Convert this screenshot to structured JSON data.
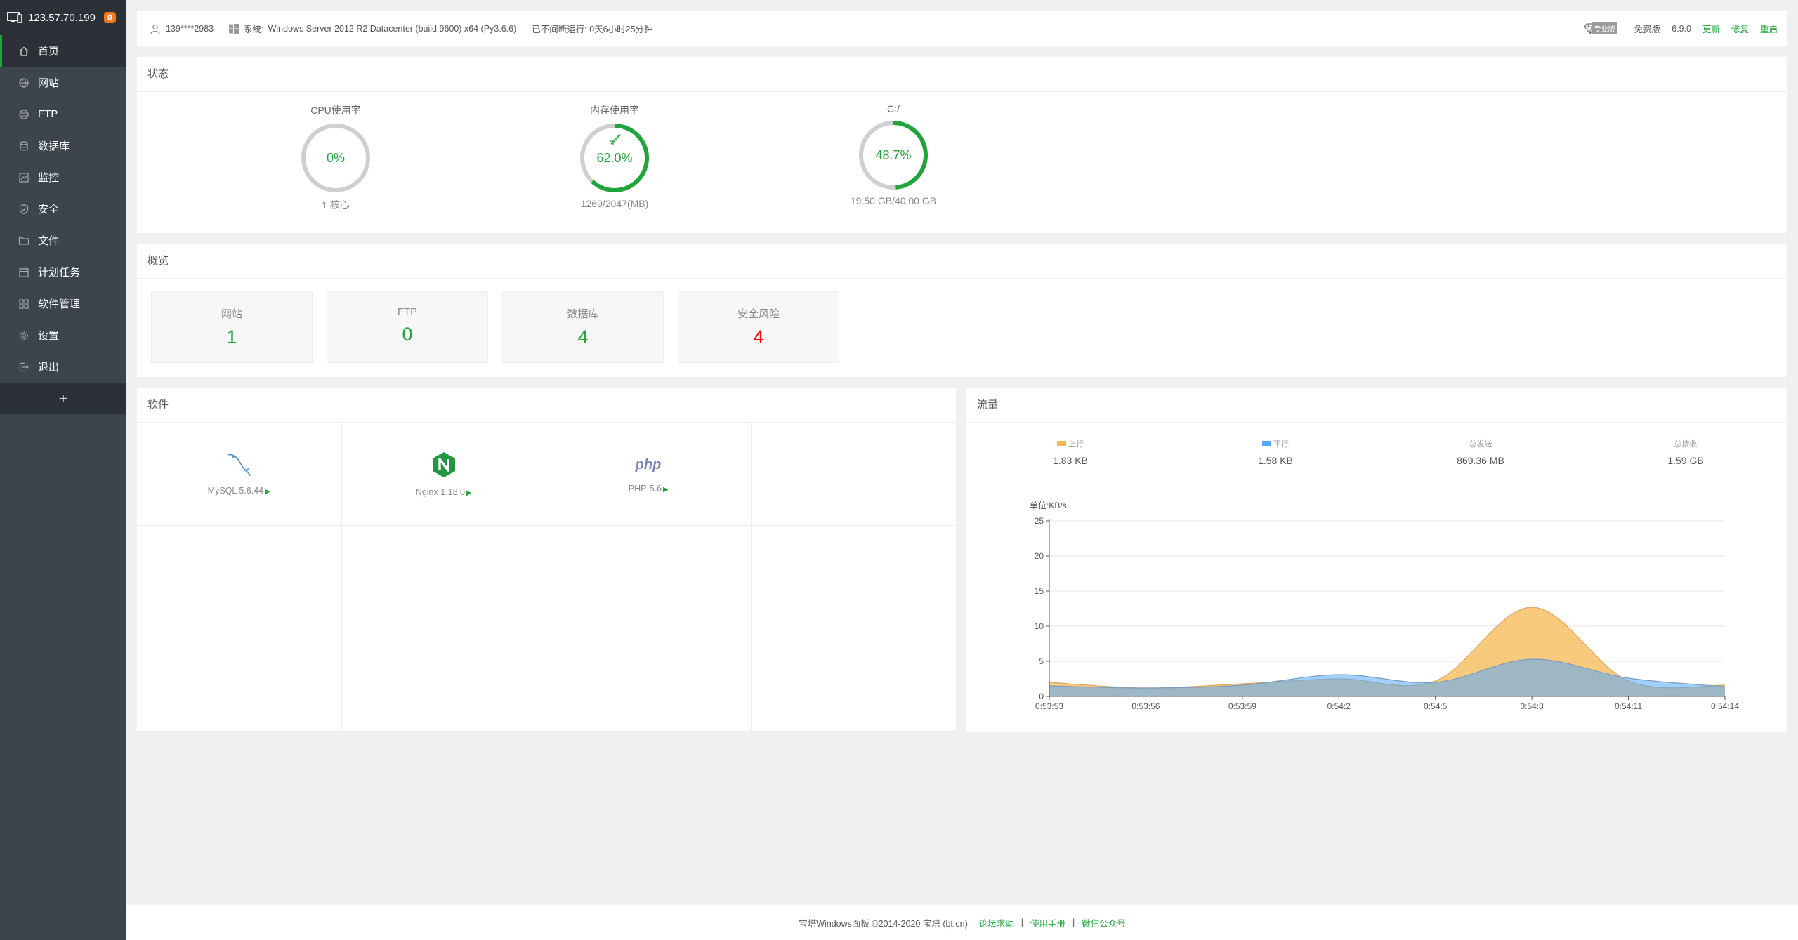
{
  "sidebar": {
    "host": "123.57.70.199",
    "badge": "0",
    "items": [
      {
        "label": "首页",
        "icon": "home-icon"
      },
      {
        "label": "网站",
        "icon": "globe-icon"
      },
      {
        "label": "FTP",
        "icon": "ftp-icon"
      },
      {
        "label": "数据库",
        "icon": "database-icon"
      },
      {
        "label": "监控",
        "icon": "monitor-icon"
      },
      {
        "label": "安全",
        "icon": "shield-icon"
      },
      {
        "label": "文件",
        "icon": "folder-icon"
      },
      {
        "label": "计划任务",
        "icon": "calendar-icon"
      },
      {
        "label": "软件管理",
        "icon": "grid-icon"
      },
      {
        "label": "设置",
        "icon": "gear-icon"
      },
      {
        "label": "退出",
        "icon": "logout-icon"
      }
    ],
    "add": "+"
  },
  "topbar": {
    "user": "139****2983",
    "system_label": "系统:",
    "system": "Windows Server 2012 R2 Datacenter (build 9600) x64 (Py3.6.6)",
    "uptime": "已不间断运行: 0天6小时25分钟",
    "pro_tag": "专业版",
    "free": "免费版",
    "version": "6.9.0",
    "update": "更新",
    "repair": "修复",
    "restart": "重启"
  },
  "status": {
    "title": "状态",
    "gauges": [
      {
        "title": "CPU使用率",
        "value": "0%",
        "percent": 0,
        "sub": "1 核心"
      },
      {
        "title": "内存使用率",
        "value": "62.0%",
        "percent": 62.0,
        "sub": "1269/2047(MB)"
      },
      {
        "title": "C:/",
        "value": "48.7%",
        "percent": 48.7,
        "sub": "19.50 GB/40.00 GB"
      }
    ]
  },
  "overview": {
    "title": "概览",
    "cards": [
      {
        "label": "网站",
        "value": "1",
        "color": "#20a53a"
      },
      {
        "label": "FTP",
        "value": "0",
        "color": "#20a53a"
      },
      {
        "label": "数据库",
        "value": "4",
        "color": "#20a53a"
      },
      {
        "label": "安全风险",
        "value": "4",
        "color": "#ff0000"
      }
    ]
  },
  "software": {
    "title": "软件",
    "items": [
      {
        "name": "MySQL 5.6.44",
        "icon": "mysql-icon"
      },
      {
        "name": "Nginx 1.18.0",
        "icon": "nginx-icon"
      },
      {
        "name": "PHP-5.6",
        "icon": "php-icon",
        "logo_text": "php"
      }
    ]
  },
  "traffic": {
    "title": "流量",
    "stats": [
      {
        "label": "上行",
        "value": "1.83 KB",
        "swatch": "#f7b851"
      },
      {
        "label": "下行",
        "value": "1.58 KB",
        "swatch": "#52a9ff"
      },
      {
        "label": "总发送",
        "value": "869.36 MB"
      },
      {
        "label": "总接收",
        "value": "1.59 GB"
      }
    ]
  },
  "chart_data": {
    "type": "area",
    "ylabel": "单位:KB/s",
    "ylim": [
      0,
      25
    ],
    "yticks": [
      0,
      5,
      10,
      15,
      20,
      25
    ],
    "categories": [
      "0:53:53",
      "0:53:56",
      "0:53:59",
      "0:54:2",
      "0:54:5",
      "0:54:8",
      "0:54:11",
      "0:54:14"
    ],
    "grid": true,
    "series": [
      {
        "name": "上行",
        "color": "#f7b851",
        "values": [
          2.0,
          1.2,
          1.8,
          2.5,
          2.2,
          12.7,
          2.2,
          1.6
        ]
      },
      {
        "name": "下行",
        "color": "#52a9ff",
        "values": [
          1.5,
          1.2,
          1.6,
          3.1,
          2.0,
          5.3,
          2.6,
          1.4
        ]
      }
    ]
  },
  "footer": {
    "copyright": "宝塔Windows面板 ©2014-2020 宝塔 (bt.cn)",
    "links": [
      "论坛求助",
      "使用手册",
      "微信公众号"
    ],
    "sep": "|"
  }
}
